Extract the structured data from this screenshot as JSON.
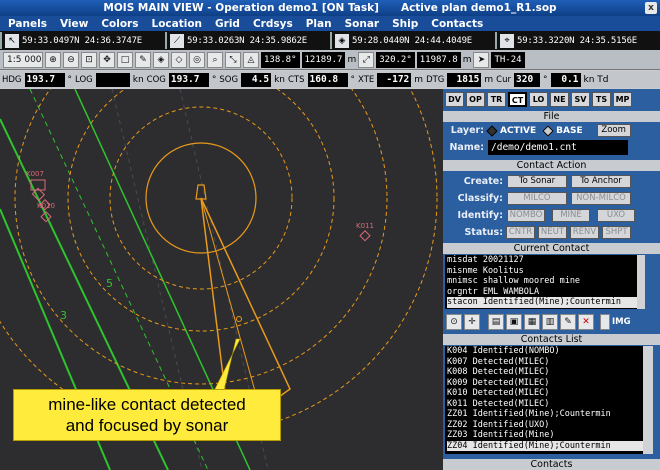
{
  "window": {
    "title": "MOIS MAIN VIEW - Operation demo1 [ON Task]",
    "plan": "Active plan demo1_R1.sop",
    "close": "x"
  },
  "menu": [
    "Panels",
    "View",
    "Colors",
    "Location",
    "Grid",
    "Crdsys",
    "Plan",
    "Sonar",
    "Ship",
    "Contacts"
  ],
  "coords": [
    {
      "icon": "cursor-icon",
      "glyph": "↖",
      "text": "59:33.0497N  24:36.3747E"
    },
    {
      "icon": "ruler-icon",
      "glyph": "⟋",
      "text": "59:33.0263N  24:35.9862E"
    },
    {
      "icon": "target-icon",
      "glyph": "◈",
      "text": "59:28.0440N  24:44.4049E"
    },
    {
      "icon": "waypoint-icon",
      "glyph": "⌖",
      "text": "59:33.3220N  24:35.5156E"
    }
  ],
  "toolbar": {
    "scale": "1:5 000",
    "bearing1": "138.8°",
    "range1": "12189.7",
    "unit1": "m",
    "bearing2": "320.2°",
    "range2": "11987.8",
    "unit2": "m",
    "th": "TH-24"
  },
  "nav": [
    {
      "label": "HDG",
      "value": "193.7",
      "unit": "°"
    },
    {
      "label": "LOG",
      "value": "",
      "unit": "kn"
    },
    {
      "label": "COG",
      "value": "193.7",
      "unit": "°"
    },
    {
      "label": "SOG",
      "value": "4.5",
      "unit": "kn"
    },
    {
      "label": "CTS",
      "value": "160.8",
      "unit": "°"
    },
    {
      "label": "XTE",
      "value": "-172",
      "unit": "m"
    },
    {
      "label": "DTG",
      "value": "1815",
      "unit": "m"
    },
    {
      "label": "Cur",
      "value": "320",
      "unit": "°"
    },
    {
      "label": "",
      "value": "0.1",
      "unit": "kn Td"
    }
  ],
  "map": {
    "contacts": [
      "K007",
      "K010",
      "K011"
    ],
    "lanes": [
      "5",
      "3"
    ],
    "callout_line1": "mine-like contact detected",
    "callout_line2": "and focused by sonar"
  },
  "panel": {
    "tabs": [
      "DV",
      "OP",
      "TR",
      "CT",
      "LO",
      "NE",
      "SV",
      "TS",
      "MP"
    ],
    "active_tab": "CT",
    "file": {
      "section": "File",
      "layer_label": "Layer:",
      "layer_active": "ACTIVE",
      "layer_base": "BASE",
      "zoom": "Zoom",
      "name_label": "Name:",
      "name_value": "/demo/demo1.cnt"
    },
    "action": {
      "section": "Contact Action",
      "create_label": "Create:",
      "create": [
        "To Sonar",
        "To Anchor"
      ],
      "classify_label": "Classify:",
      "classify": [
        "MILCO",
        "NON-MILCO"
      ],
      "identify_label": "Identify:",
      "identify": [
        "NOMBO",
        "MINE",
        "UXO"
      ],
      "status_label": "Status:",
      "status": [
        "CNTR",
        "NEUT",
        "RENV",
        "SHPT"
      ]
    },
    "current": {
      "section": "Current Contact",
      "lines": [
        "misdat 20021127",
        "misnme Koolitus",
        "mnimsc shallow moored mine",
        "orgntr EML WAMBOLA",
        "stacon Identified(Mine);Countermin"
      ]
    },
    "img_label": "IMG",
    "list": {
      "section": "Contacts List",
      "rows": [
        "K004  Identified(NOMBO)",
        "K007  Detected(MILEC)",
        "K008  Detected(MILEC)",
        "K009  Detected(MILEC)",
        "K010  Detected(MILEC)",
        "K011  Detected(MILEC)",
        "ZZ01  Identified(Mine);Countermin",
        "ZZ02  Identified(UXO)",
        "ZZ03  Identified(Mine)",
        "ZZ04  Identified(Mine);Countermin"
      ]
    },
    "bottom": "Contacts"
  },
  "colors": {
    "map_bg": "#2d2d2f",
    "range_ring": "#e89a1a",
    "lane_green": "#2ec42e",
    "contact_red": "#d86a7a",
    "panel_blue": "#2c5fa0",
    "callout": "#ffeb3b"
  }
}
